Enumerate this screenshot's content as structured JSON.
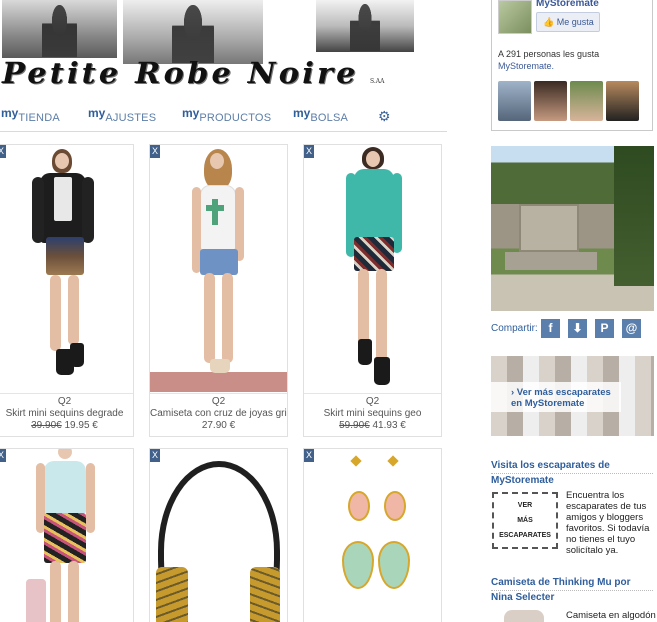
{
  "brand": {
    "title": "Petite Robe Noire",
    "subtitle": "S.AA"
  },
  "nav": {
    "prefix": "my",
    "items": [
      "TIENDA",
      "AJUSTES",
      "PRODUCTOS",
      "BOLSA"
    ],
    "settings_icon": "gear-icon"
  },
  "products": [
    {
      "brand": "Q2",
      "name": "Skirt mini sequins degrade",
      "old_price": "39.90€",
      "price": "19.95 €"
    },
    {
      "brand": "Q2",
      "name": "Camiseta con cruz de joyas gris",
      "old_price": "",
      "price": "27.90 €"
    },
    {
      "brand": "Q2",
      "name": "Skirt mini sequins geo",
      "old_price": "59.90€",
      "price": "41.93 €"
    },
    {
      "brand": "",
      "name": "",
      "old_price": "",
      "price": ""
    },
    {
      "brand": "",
      "name": "",
      "old_price": "",
      "price": ""
    },
    {
      "brand": "",
      "name": "",
      "old_price": "",
      "price": ""
    }
  ],
  "close_symbol": "X",
  "facebook": {
    "page_name": "MyStoremate",
    "like_label": "Me gusta",
    "count_text": "A 291 personas les gusta",
    "count_link": "MyStoremate."
  },
  "share": {
    "label": "Compartir:",
    "icons": [
      "facebook-icon",
      "cart-icon",
      "pinterest-icon",
      "email-icon"
    ],
    "glyphs": [
      "f",
      "⬇",
      "P",
      "@"
    ]
  },
  "showcase": {
    "line1": "› Ver más escaparates",
    "line2": "en MyStoremate"
  },
  "visit": {
    "heading": "Visita los escaparates de MyStoremate",
    "button_lines": [
      "VER",
      "MÁS",
      "ESCAPARATES"
    ],
    "text": "Encuentra los escaparates de tus amigos y bloggers favoritos. Si todavía no tienes el tuyo solicítalo ya."
  },
  "camiseta": {
    "heading": "Camiseta de Thinking Mu por Nina Selecter",
    "text": "Camiseta en algodón"
  },
  "colors": {
    "accent": "#2f5e9c",
    "nav_text": "#5c7ea8",
    "close_bg": "#42618a",
    "facebook": "#3b5998"
  }
}
